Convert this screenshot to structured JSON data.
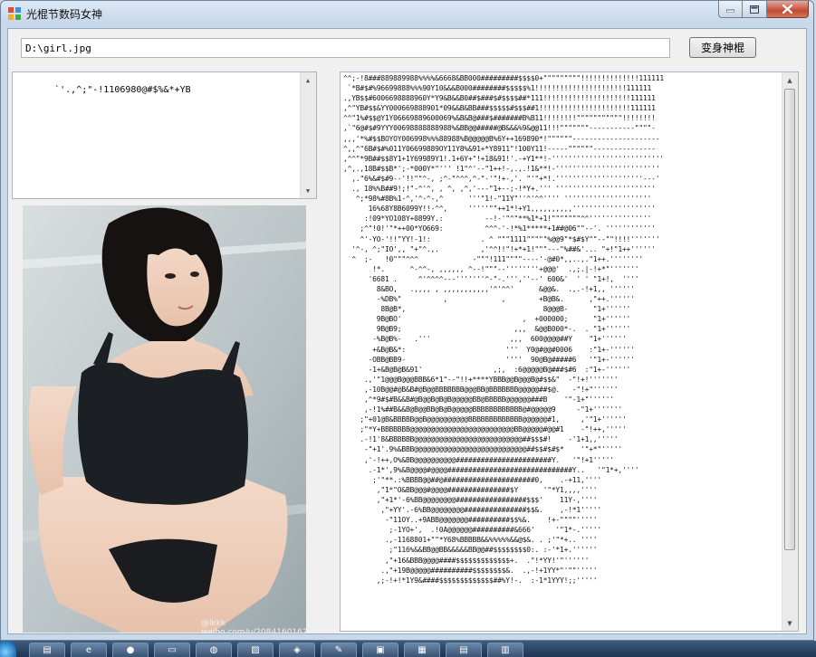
{
  "window": {
    "title": "光棍节数码女神"
  },
  "controls": {
    "path_value": "D:\\girl.jpg",
    "transform_button_label": "变身神棍",
    "charset_text": "`'.,^;\"-!1106980@#$%&*+YB"
  },
  "photo": {
    "watermark_text": "@lkkk\nweibo.com/u/2084160162"
  },
  "ascii_art": {
    "lines": [
      "^^;-!8###889889988%%%%&6668&BB000#########$$$$0+\"\"\"\"\"\"\"\"\"!!!!!!!!!!!!!!111111",
      " `*B#$#%96699888%%%90Y10&&&B000########$$$$$%1!!!!!!!!!!!!!!!!!!!!!!111111",
      ".,YB$$#6006698888960Y*Y9&B&&B0##$###$#$$$$##*111!!!!!!!!!!!!!!!!!!!!!111111",
      ",^\"YB#$$&YY000669888901*09&&B&BB###$$$$$#$$$##1!!!!!!!!!!!!!!!!!!!!!!111111",
      "^^\"1%#$$@Y1Y06669889600069%&B&B@###$#######B%B11!!!!!!!!\"\"\"\"\"\"\"\"\"\"\"!!!!!!!!",
      ",`\"6@#$#9YYY00698888888988%&BB@@#####@B&&&%9&@@11!!!\"\"\"\"\"\"\"-----------\"\"\"\"-",
      ",,,'*%#$$BOYOY006998%%%88988%B@@@@@B%6Y++169890*!\"\"\"\"\"\"---------------------",
      "^,,^\"6B#$#%011Y06699889OY11Y8%&91+*Y8911\"!100Y11!-----\"\"\"\"\"\"---------------",
      ",^^\"*9B##$$8Y1+1Y69989Y1!.1+6Y+\"!+18&91!'.-+Y1**!-'''''''''''''''''''''''''''",
      ",^,.,18B#$$B*';-*000Y*\"''' !1\"^'--\"1++!-,.,.!1&**!-'''''''''''''''''''''''''",
      "  ,.\"6%&#$#9--'!!\"\"^-, ;^-\"^^^,^-\"-'\"!+-,'. \"'\"+*!.'''''''''''''''''''''---'",
      "  ., 18%%B##9!;!\"-^'^, , ^, ,^,'---\"1+--;-!*Y+.''' ''''''''''''''''''''''''",
      "   ^;*98%#8B%1-^,'^-^-,^      '''\"1!-\"11Y\"''^'^^'''' '''''''''''''''''''''",
      "      16%68Y8B6099Y!!-^^,     '''''\"\"++1*!+Y1,,,,,,,,,,''''''''''''''''''''",
      "     :!09*YO108Y+0899Y.:          --!-'\"^\"**%1*+1!\"\"\"\"\"\"\"^^'''''''''''''''",
      "    ;^\"!0!'\"*++00*YO669:          ^^^-'-!*%1*****+1##@06\"\"--'. ''''''''''''",
      "    ^'-YO-'!!\"YY!-1!:            . ^ \"\"\"1111\"\"\"\"\"%@@9\"*$#$Y\"\"--\"\"!!!!'''''''",
      "  '^-, ^;\"IO',, \"+\"^.,.          ,'^^!!\"!+*+1!\"\"\"---\"%##&'... \"+!\"1++''''''",
      "  ^  ;-   !0\"\"\"^^^             -\"\"\"!111\"\"\"\"----'-@#0*,,..,.\"1++.''''''''",
      "       !*.      ^-^^-, ,,,,,, ^--!\"\"\"--''''''''+@@@'  .,;.|-!+*\"'''''''",
      "      '6681 .     ^'^^^^---'''''''^-\"-.''',''--' 600&'  ' ' \"1+!,  ''''",
      "        8&BO,   .,,,, , ,,,,,,,,,,,'^'^^'      &@@&.  .,.-!+1,, ''''''",
      "        -%DB%\"          ,             ,        +B@B&.      ,\"++.''''''",
      "         8B@B*,                                 8@@@B-      \"1+''''''",
      "        9B@BO'                             ,  +000000;      \"1+''''''",
      "        9B@B9;                           ,,,  &@@B000*-.  . \"1+''''''",
      "       -%B@B%-   .'''                   ,,,  600@@@@##Y    \"1+''''''",
      "       +&B@B&*:                        '''  Y0@#@@#0006    :\"1+-''''''",
      "      -OBB@BB9-                        ''''  90@B@#####6   '\"1+-''''''",
      "      -1+&B@B@B&91'                 ,;,  :6@@@@@B@###$#6  :\"1+-''''''",
      "     .,'\"1@@@B@@@BBB&6*1\"--\"!!+****YBBB@@B@@@B@#$$&\"  -\"!+!'''''''",
      "     ,-10B@@#@B&B#@B@@BBBBBBB@@@BB@BBBBBBB@@@@@##$@.   -\"!+\"''''''",
      "     ,^*9#$#B&&B#@B@@B@B@B@@@@@BB@BBBBB@@@@@@###B    '\"-1+\"''''''",
      "     ,-!1%##B&&B@B@@BB@B@B@@@@@BBBBBBBBBBBB@#@@@@@9     -\"1+'''''''",
      "    ;\"+01@B&BBBBB@@B@@@@@@@@@@BBBBBBBBBBBBB@@@@@@#1,     ,'\"1+''''''",
      "    ;\"*Y+BBBBBBB@@@@@@@@@@@@@@@@@@@@@@@@@BB@@@@@#@@#1    -\"!++,'''''",
      "    .-!1'8&BBBBBB@@@@@@@@@@@@@@@@@@@@@@@@@@##$$$#!    -'1+1,,'''''",
      "     -\"+1'.9%&BBB@@@@@@@@@@@@@@@@@@@@@@@@@@@##$$#$#$*    '\"+*\"'''''",
      "     ,'-!++,O%&BB@@@@@@@@@@#######################Y.   '\"!+1'''''",
      "      .-1*',9%&B@@@@#@@@@##############################Y..   '\"1*+,''''",
      "       ;'\"**.:%BBBB@@##@######################0,    .-+11,''''",
      "        ,\"1*\"O&BB@@@#@@@@###############$Y      '\"*Y1,,,,''''",
      "        ,\"+1*'-6%BB@@@@@@@@#################$$$'    11Y-,''''",
      "         ,\"+YY'.-6%BB@@@@@@@@###############$$&.    ,-!*1'''''",
      "          -\"11OY..+9ABB@@@@@@@##########$$%&.    !+-\"\"\"\"'''''",
      "           ;-1YO+',  .!0A@@@@@@##########&666'     '\"1*-.'''''",
      "          .,-1168801+\"\"*Y68%BBBBB&&%%%%%&&@$&. . ;'\"*+.. ''''",
      "           ;\"116%&&BB@@BB&&&&&BB@@##$$$$$$$$0:. :-'*1+.''''''",
      "          ,\"+16&BBB@@@@####$$$$$$$$$$$$$+.  .\"!*YY!'\"''''''",
      "         .,\"+19B@@@@@##########$$$$$$$$&.  .,-!+1YY*\"'\"\"'''''",
      "        ,;-!+!*1Y9&####$$$$$$$$$$$$$##%Y!-.  :-1*1YYY!;;'''''"
    ]
  }
}
